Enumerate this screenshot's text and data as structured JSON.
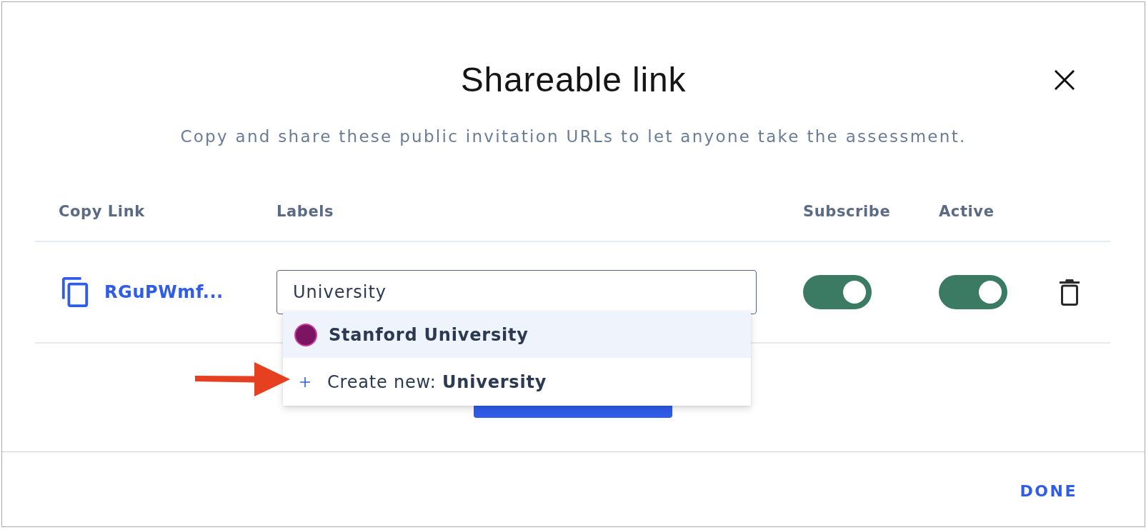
{
  "title": "Shareable link",
  "subtitle": "Copy and share these public invitation URLs to let anyone take the assessment.",
  "table": {
    "columns": [
      "Copy Link",
      "Labels",
      "Subscribe",
      "Active"
    ],
    "rows": [
      {
        "link": "RGuPWmf...",
        "labels": {
          "value": "University",
          "suggestions": [
            {
              "kind": "label",
              "text": "Stanford University",
              "color": "#7b1562",
              "selected": true
            },
            {
              "kind": "create",
              "text": "Create new: **University**",
              "selected": false
            }
          ]
        },
        "subscribe": {
          "on": true
        },
        "active": {
          "on": true
        }
      }
    ]
  },
  "footer": {
    "done": "DONE"
  }
}
